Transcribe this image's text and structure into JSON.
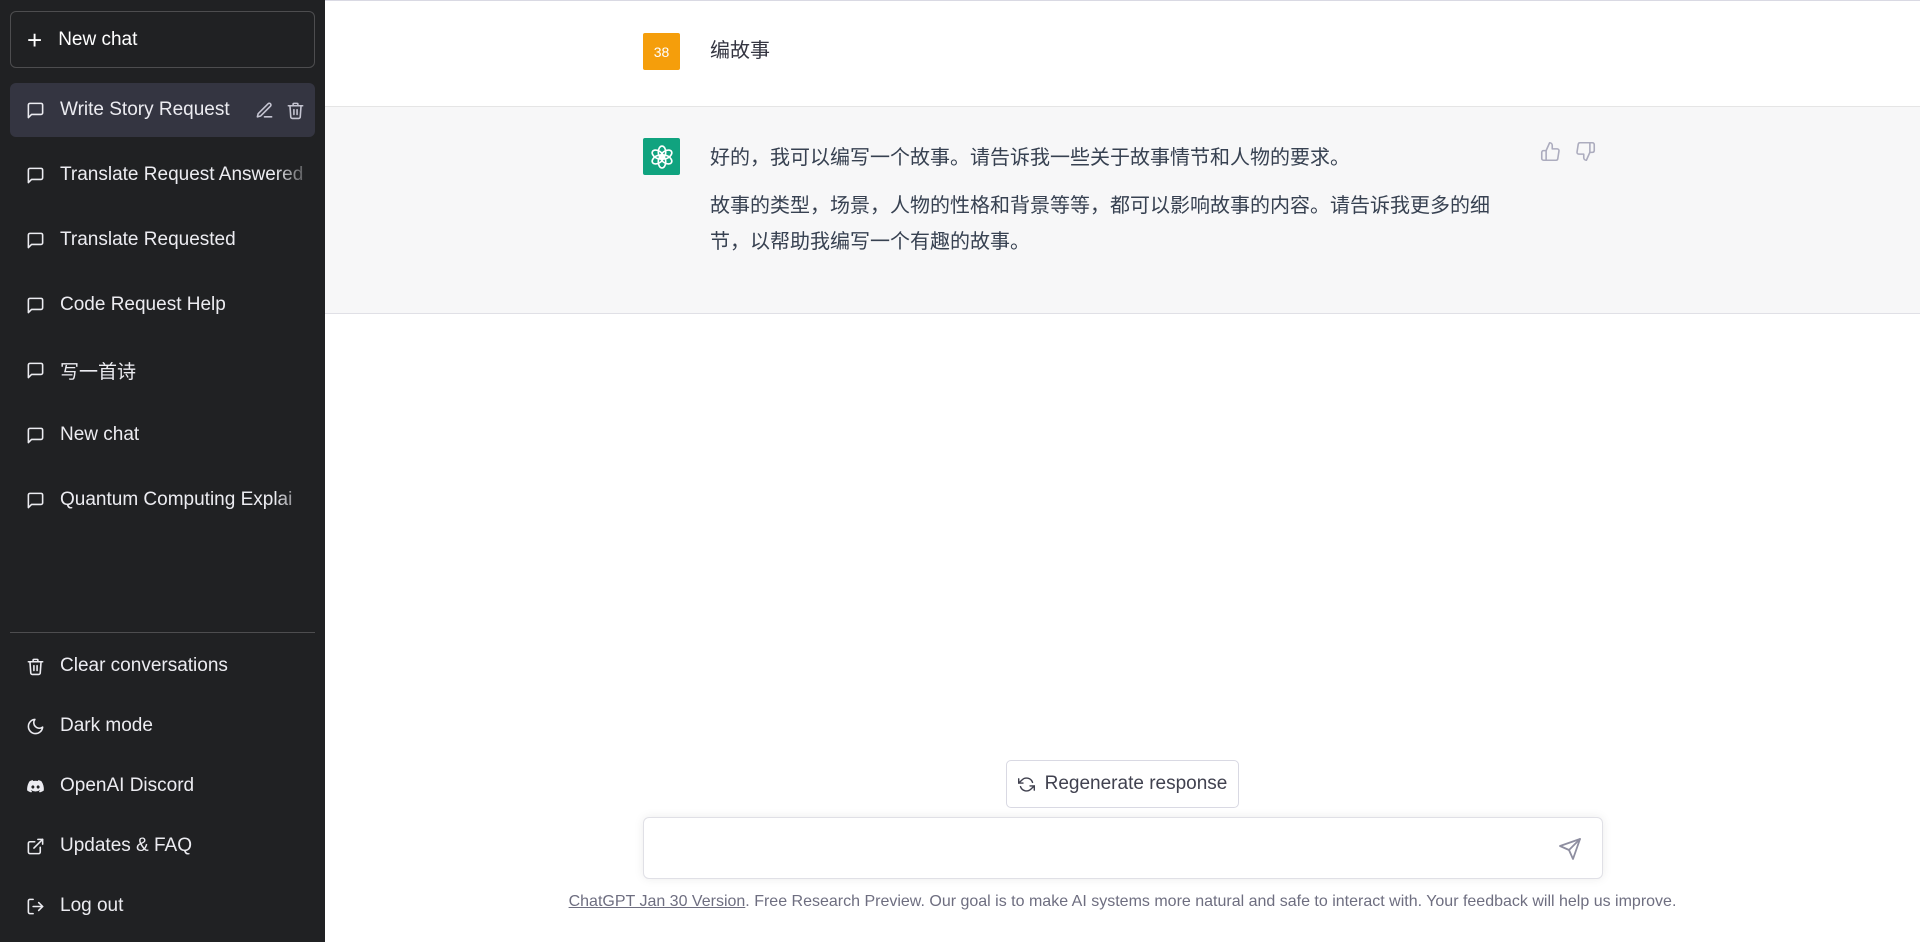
{
  "sidebar": {
    "new_chat_label": "New chat",
    "chats": [
      {
        "label": "Write Story Request",
        "active": true
      },
      {
        "label": "Translate Request Answered"
      },
      {
        "label": "Translate Requested"
      },
      {
        "label": "Code Request Help"
      },
      {
        "label": "写一首诗"
      },
      {
        "label": "New chat"
      },
      {
        "label": "Quantum Computing Explai"
      }
    ],
    "bottom_menu": [
      {
        "label": "Clear conversations",
        "icon": "trash-icon"
      },
      {
        "label": "Dark mode",
        "icon": "moon-icon"
      },
      {
        "label": "OpenAI Discord",
        "icon": "discord-icon"
      },
      {
        "label": "Updates & FAQ",
        "icon": "external-link-icon"
      },
      {
        "label": "Log out",
        "icon": "logout-icon"
      }
    ]
  },
  "conversation": {
    "user_avatar_text": "38",
    "user_message": "编故事",
    "bot_paragraphs": [
      "好的，我可以编写一个故事。请告诉我一些关于故事情节和人物的要求。",
      "故事的类型，场景，人物的性格和背景等等，都可以影响故事的内容。请告诉我更多的细节，以帮助我编写一个有趣的故事。"
    ]
  },
  "regenerate_label": "Regenerate response",
  "composer": {
    "value": "",
    "placeholder": ""
  },
  "footer": {
    "link_text": "ChatGPT Jan 30 Version",
    "text": ". Free Research Preview. Our goal is to make AI systems more natural and safe to interact with. Your feedback will help us improve."
  },
  "colors": {
    "sidebar_bg": "#202123",
    "active_item_bg": "#343541",
    "user_avatar": "#f59e0b",
    "bot_avatar": "#10a37f",
    "bot_message_bg": "#f7f7f8"
  }
}
